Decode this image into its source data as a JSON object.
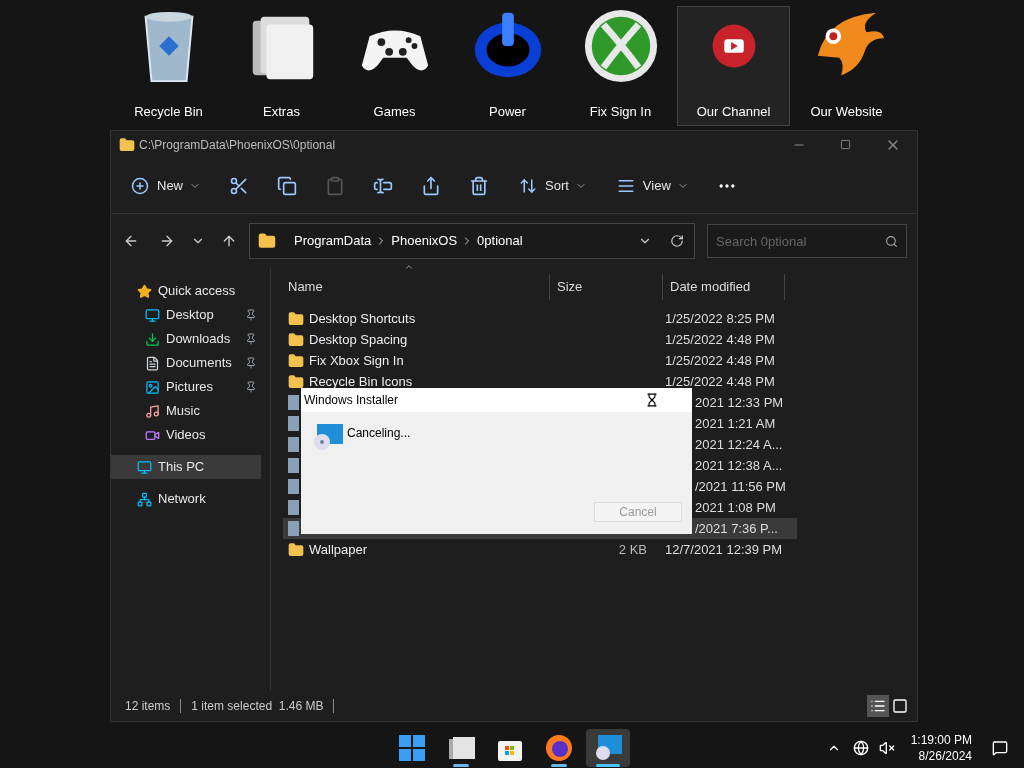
{
  "desktop_icons": [
    {
      "label": "Recycle Bin",
      "selected": false
    },
    {
      "label": "Extras",
      "selected": false
    },
    {
      "label": "Games",
      "selected": false
    },
    {
      "label": "Power",
      "selected": false
    },
    {
      "label": "Fix Sign In",
      "selected": false
    },
    {
      "label": "Our Channel",
      "selected": true
    },
    {
      "label": "Our Website",
      "selected": false
    }
  ],
  "window": {
    "title": "C:\\ProgramData\\PhoenixOS\\0ptional"
  },
  "toolbar": [
    {
      "kind": "menu",
      "label": "New",
      "disabled": false
    },
    {
      "kind": "icon",
      "disabled": false
    },
    {
      "kind": "icon",
      "disabled": false
    },
    {
      "kind": "icon",
      "disabled": true
    },
    {
      "kind": "icon",
      "disabled": false
    },
    {
      "kind": "icon",
      "disabled": false
    },
    {
      "kind": "icon",
      "disabled": false
    },
    {
      "kind": "menu",
      "label": "Sort",
      "disabled": false
    },
    {
      "kind": "menu",
      "label": "View",
      "disabled": false
    },
    {
      "kind": "more",
      "disabled": false
    }
  ],
  "address": {
    "path": [
      "ProgramData",
      "PhoenixOS",
      "0ptional"
    ],
    "search_placeholder": "Search 0ptional"
  },
  "sidebar": {
    "items": [
      {
        "label": "Quick access",
        "selected": false,
        "children": [
          {
            "label": "Desktop",
            "pinned": true
          },
          {
            "label": "Downloads",
            "pinned": true
          },
          {
            "label": "Documents",
            "pinned": true
          },
          {
            "label": "Pictures",
            "pinned": true
          },
          {
            "label": "Music",
            "pinned": false
          },
          {
            "label": "Videos",
            "pinned": false
          }
        ]
      },
      {
        "label": "This PC",
        "selected": true
      },
      {
        "label": "Network",
        "selected": false
      }
    ]
  },
  "table": {
    "columns": [
      {
        "label": "Name",
        "sorted": true
      },
      {
        "label": "Size",
        "sorted": false
      },
      {
        "label": "Date modified",
        "sorted": false
      }
    ],
    "rows": [
      {
        "kind": "folder",
        "name": "Desktop Shortcuts",
        "date": "1/25/2022 8:25 PM",
        "selected": false
      },
      {
        "kind": "folder",
        "name": "Desktop Spacing",
        "date": "1/25/2022 4:48 PM",
        "selected": false
      },
      {
        "kind": "folder",
        "name": "Fix Xbox Sign In",
        "date": "1/25/2022 4:48 PM",
        "selected": false
      },
      {
        "kind": "folder",
        "name": "Recycle Bin Icons",
        "date": "1/25/2022 4:48 PM",
        "selected": false
      },
      {
        "kind": "covered",
        "date": "2021 12:33 PM",
        "selected": false
      },
      {
        "kind": "covered",
        "date": "2021 1:21 AM",
        "selected": false
      },
      {
        "kind": "covered",
        "date": "2021 12:24 A...",
        "selected": false
      },
      {
        "kind": "covered",
        "date": "2021 12:38 A...",
        "selected": false
      },
      {
        "kind": "covered",
        "date": "/2021 11:56 PM",
        "selected": false
      },
      {
        "kind": "covered",
        "date": "2021 1:08 PM",
        "selected": false
      },
      {
        "kind": "covered",
        "date": "/2021 7:36 P...",
        "selected": true
      },
      {
        "kind": "folder",
        "name": "Wallpaper",
        "size": "2 KB",
        "date": "12/7/2021 12:39 PM",
        "selected": false
      }
    ]
  },
  "status_bar": {
    "items": "12 items",
    "selection": "1 item selected  1.46 MB",
    "views": [
      {
        "selected": true
      },
      {
        "selected": false
      }
    ]
  },
  "dialog": {
    "title": "Windows Installer",
    "message": "Canceling...",
    "button": {
      "label": "Cancel",
      "disabled": true
    }
  },
  "taskbar": {
    "apps": [
      {
        "running": false,
        "selected": false
      },
      {
        "running": true,
        "selected": false
      },
      {
        "running": false,
        "selected": false
      },
      {
        "running": true,
        "selected": false
      },
      {
        "running": true,
        "selected": true
      }
    ],
    "time": "1:19:00 PM",
    "date": "8/26/2024"
  }
}
